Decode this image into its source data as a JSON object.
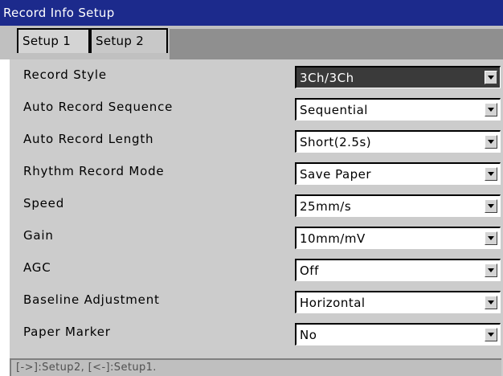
{
  "window": {
    "title": "Record Info Setup"
  },
  "tabs": [
    {
      "label": "Setup 1",
      "active": true
    },
    {
      "label": "Setup 2",
      "active": false
    }
  ],
  "settings": [
    {
      "label": "Record Style",
      "value": "3Ch/3Ch",
      "selected": true
    },
    {
      "label": "Auto Record Sequence",
      "value": "Sequential",
      "selected": false
    },
    {
      "label": "Auto Record Length",
      "value": "Short(2.5s)",
      "selected": false
    },
    {
      "label": "Rhythm Record Mode",
      "value": "Save Paper",
      "selected": false
    },
    {
      "label": "Speed",
      "value": "25mm/s",
      "selected": false
    },
    {
      "label": "Gain",
      "value": "10mm/mV",
      "selected": false
    },
    {
      "label": "AGC",
      "value": "Off",
      "selected": false
    },
    {
      "label": "Baseline Adjustment",
      "value": "Horizontal",
      "selected": false
    },
    {
      "label": "Paper Marker",
      "value": "No",
      "selected": false
    }
  ],
  "hint": "[->]:Setup2, [<-]:Setup1.",
  "colors": {
    "title_bg": "#1c2a8c",
    "panel_bg": "#cccccc",
    "selected_bg": "#3a3a3a"
  }
}
